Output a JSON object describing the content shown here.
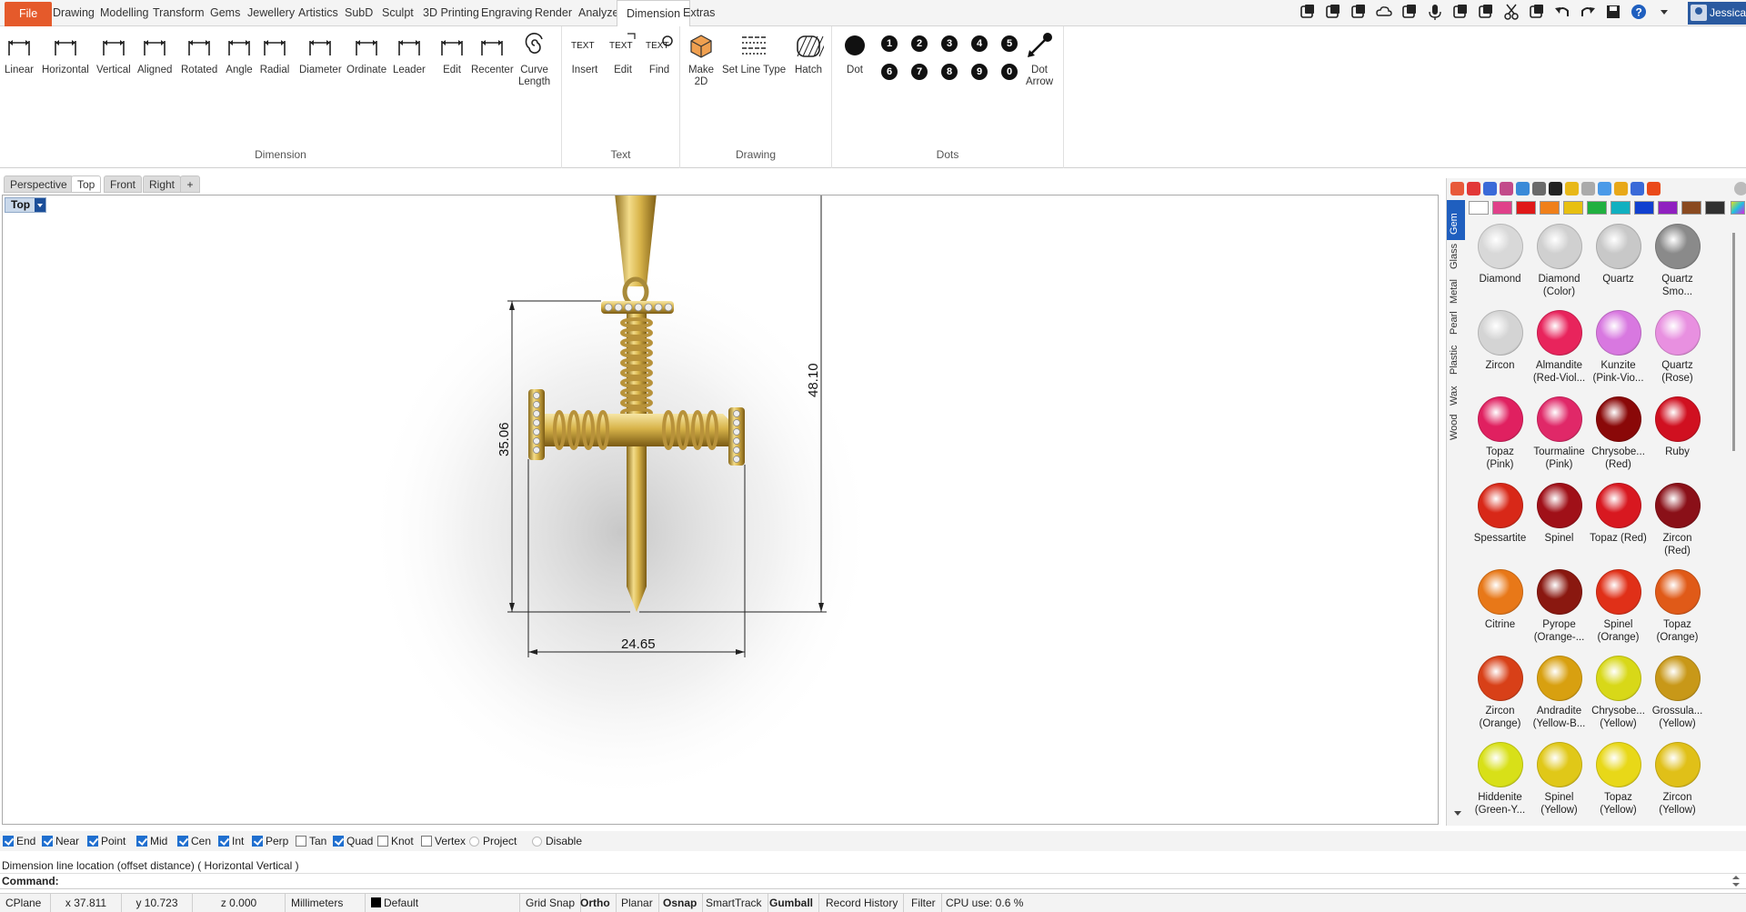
{
  "menu": {
    "tabs": [
      "File",
      "Drawing",
      "Modelling",
      "Transform",
      "Gems",
      "Jewellery",
      "Artistics",
      "SubD",
      "Sculpt",
      "3D Printing",
      "Engraving",
      "Render",
      "Analyze",
      "Dimension",
      "Extras"
    ],
    "active_tab": "Dimension",
    "user_name": "Jessica"
  },
  "ribbon": {
    "groups": [
      {
        "title": "Dimension",
        "buttons": [
          "Linear",
          "Horizontal",
          "Vertical",
          "Aligned",
          "Rotated",
          "Angle",
          "Radial",
          "Diameter",
          "Ordinate",
          "Leader",
          "Edit",
          "Recenter",
          "Curve\nLength"
        ]
      },
      {
        "title": "Text",
        "buttons": [
          "Insert",
          "Edit",
          "Find"
        ]
      },
      {
        "title": "Drawing",
        "buttons": [
          "Make\n2D",
          "Set Line Type",
          "Hatch"
        ]
      },
      {
        "title": "Dots",
        "buttons": [
          "Dot",
          "Dot\nArrow"
        ]
      }
    ],
    "dot_numbers": [
      "1",
      "2",
      "3",
      "4",
      "5",
      "6",
      "7",
      "8",
      "9",
      "0"
    ],
    "text_icon_label": "TEXT"
  },
  "viewport": {
    "tabs": [
      "Perspective",
      "Top",
      "Front",
      "Right"
    ],
    "active_tab": "Top",
    "label": "Top",
    "dimensions": {
      "height_total": "48.10",
      "height_cross": "35.06",
      "width": "24.65"
    }
  },
  "panel": {
    "categories": [
      "Gem",
      "Glass",
      "Metal",
      "Pearl",
      "Plastic",
      "Wax",
      "Wood"
    ],
    "active_category": "Gem",
    "swatch_colors": [
      "#ffffff",
      "#e0408a",
      "#e01818",
      "#f0801a",
      "#e8c010",
      "#20b040",
      "#10b0c0",
      "#1040d0",
      "#9020c0",
      "#8a4a20",
      "#303030"
    ],
    "gems": [
      {
        "name": "Diamond",
        "color": "#d8d8d8"
      },
      {
        "name": "Diamond\n(Color)",
        "color": "#d0d0d0"
      },
      {
        "name": "Quartz",
        "color": "#c8c8c8"
      },
      {
        "name": "Quartz\nSmo...",
        "color": "#8a8a8a"
      },
      {
        "name": "Zircon",
        "color": "#d4d4d4"
      },
      {
        "name": "Almandite\n(Red-Viol...",
        "color": "#e8245c"
      },
      {
        "name": "Kunzite\n(Pink-Vio...",
        "color": "#d878e0"
      },
      {
        "name": "Quartz\n(Rose)",
        "color": "#e890e0"
      },
      {
        "name": "Topaz\n(Pink)",
        "color": "#e02060"
      },
      {
        "name": "Tourmaline\n(Pink)",
        "color": "#e02868"
      },
      {
        "name": "Chrysobe...\n(Red)",
        "color": "#8a0808"
      },
      {
        "name": "Ruby",
        "color": "#d01020"
      },
      {
        "name": "Spessartite",
        "color": "#d82818"
      },
      {
        "name": "Spinel",
        "color": "#a01018"
      },
      {
        "name": "Topaz (Red)",
        "color": "#d81820"
      },
      {
        "name": "Zircon\n(Red)",
        "color": "#8a1018"
      },
      {
        "name": "Citrine",
        "color": "#e87818"
      },
      {
        "name": "Pyrope\n(Orange-...",
        "color": "#8a1810"
      },
      {
        "name": "Spinel\n(Orange)",
        "color": "#e03018"
      },
      {
        "name": "Topaz\n(Orange)",
        "color": "#e05a18"
      },
      {
        "name": "Zircon\n(Orange)",
        "color": "#d84018"
      },
      {
        "name": "Andradite\n(Yellow-B...",
        "color": "#d8a010"
      },
      {
        "name": "Chrysobe...\n(Yellow)",
        "color": "#d8d818"
      },
      {
        "name": "Grossula...\n(Yellow)",
        "color": "#c89818"
      },
      {
        "name": "Hiddenite\n(Green-Y...",
        "color": "#d8e018"
      },
      {
        "name": "Spinel\n(Yellow)",
        "color": "#e0c818"
      },
      {
        "name": "Topaz\n(Yellow)",
        "color": "#e8d818"
      },
      {
        "name": "Zircon\n(Yellow)",
        "color": "#e0c018"
      }
    ]
  },
  "osnap": [
    {
      "label": "End",
      "checked": true
    },
    {
      "label": "Near",
      "checked": true
    },
    {
      "label": "Point",
      "checked": true
    },
    {
      "label": "Mid",
      "checked": true
    },
    {
      "label": "Cen",
      "checked": true
    },
    {
      "label": "Int",
      "checked": true
    },
    {
      "label": "Perp",
      "checked": true
    },
    {
      "label": "Tan",
      "checked": false
    },
    {
      "label": "Quad",
      "checked": true
    },
    {
      "label": "Knot",
      "checked": false
    },
    {
      "label": "Vertex",
      "checked": false
    }
  ],
  "osnap_radios": [
    "Project",
    "Disable"
  ],
  "command": {
    "history": "Dimension line location (offset distance) ( Horizontal  Vertical )",
    "prompt": "Command:"
  },
  "status": {
    "cplane": "CPlane",
    "x": "x 37.811",
    "y": "y 10.723",
    "z": "z 0.000",
    "units": "Millimeters",
    "layer": "Default",
    "toggles": [
      "Grid Snap",
      "Ortho",
      "Planar",
      "Osnap",
      "SmartTrack",
      "Gumball",
      "Record History",
      "Filter"
    ],
    "bold_toggles": [
      "Ortho",
      "Osnap",
      "Gumball"
    ],
    "cpu": "CPU use: 0.6 %"
  },
  "colors": {
    "accent": "#1f5fbf",
    "file_tab": "#e55a2b",
    "gold": "#d8b44a"
  }
}
